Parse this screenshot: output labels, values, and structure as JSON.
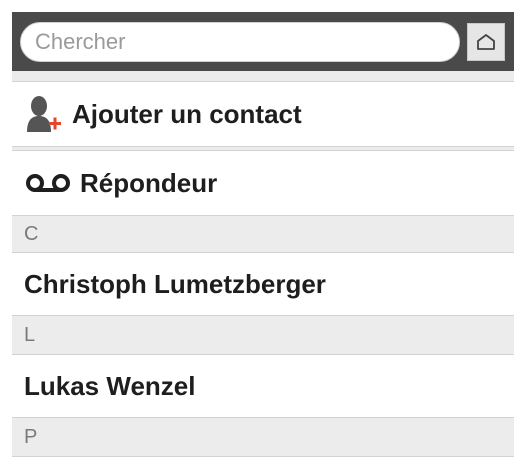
{
  "search": {
    "placeholder": "Chercher"
  },
  "actions": {
    "add_contact": {
      "label": "Ajouter un contact",
      "icon": "add-contact-icon"
    },
    "voicemail": {
      "label": "Répondeur",
      "icon": "voicemail-icon"
    }
  },
  "sections": [
    {
      "letter": "C",
      "contacts": [
        {
          "name": "Christoph Lumetzberger"
        }
      ]
    },
    {
      "letter": "L",
      "contacts": [
        {
          "name": "Lukas Wenzel"
        }
      ]
    },
    {
      "letter": "P",
      "contacts": []
    }
  ],
  "colors": {
    "accent": "#e8462a",
    "toolbar": "#4a4a4a"
  }
}
